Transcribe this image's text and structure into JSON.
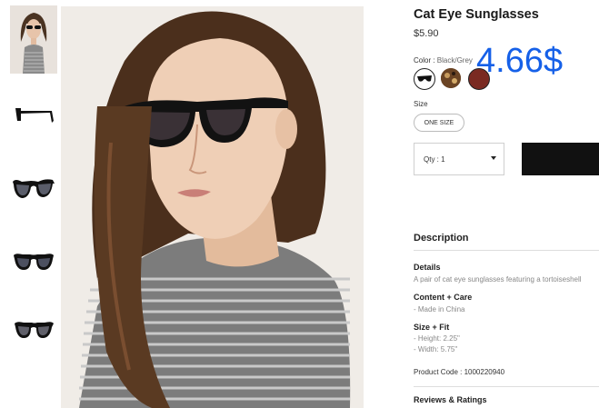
{
  "product": {
    "title": "Cat Eye Sunglasses",
    "price": "$5.90",
    "overlay_price": "4.66$"
  },
  "color": {
    "label": "Color :",
    "selected": "Black/Grey",
    "swatches": [
      {
        "name": "black",
        "hex": "#111111"
      },
      {
        "name": "tortoise",
        "hex": "#5a3a22"
      },
      {
        "name": "burgundy",
        "hex": "#7a2a22"
      }
    ]
  },
  "size": {
    "label": "Size",
    "option": "ONE SIZE"
  },
  "quantity": {
    "label": "Qty : 1"
  },
  "description": {
    "heading": "Description",
    "details_heading": "Details",
    "details_text": "A pair of cat eye sunglasses featuring a tortoiseshell",
    "content_heading": "Content + Care",
    "content_text": "- Made in China",
    "fit_heading": "Size + Fit",
    "fit_height": "- Height: 2.25\"",
    "fit_width": "- Width: 5.75\"",
    "product_code": "Product Code : 1000220940"
  },
  "reviews": {
    "label": "Reviews & Ratings"
  },
  "colors": {
    "overlay_blue": "#1560e8",
    "add_button": "#111111"
  }
}
